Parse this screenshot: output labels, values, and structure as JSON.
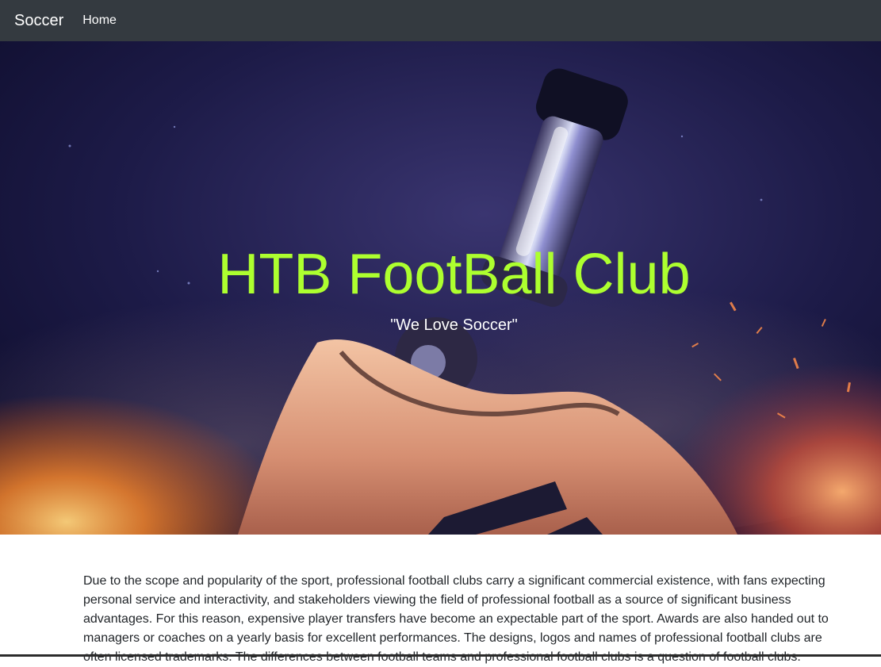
{
  "navbar": {
    "brand": "Soccer",
    "links": [
      {
        "label": "Home"
      }
    ]
  },
  "hero": {
    "title": "HTB FootBall Club",
    "subtitle": "\"We Love Soccer\""
  },
  "content": {
    "paragraph": "Due to the scope and popularity of the sport, professional football clubs carry a significant commercial existence, with fans expecting personal service and interactivity, and stakeholders viewing the field of professional football as a source of significant business advantages. For this reason, expensive player transfers have become an expectable part of the sport. Awards are also handed out to managers or coaches on a yearly basis for excellent performances. The designs, logos and names of professional football clubs are often licensed trademarks. The differences between football teams and professional football clubs is a question of football clubs."
  },
  "colors": {
    "navbar_bg": "#343a40",
    "hero_title": "#adff2f",
    "text": "#212529"
  }
}
